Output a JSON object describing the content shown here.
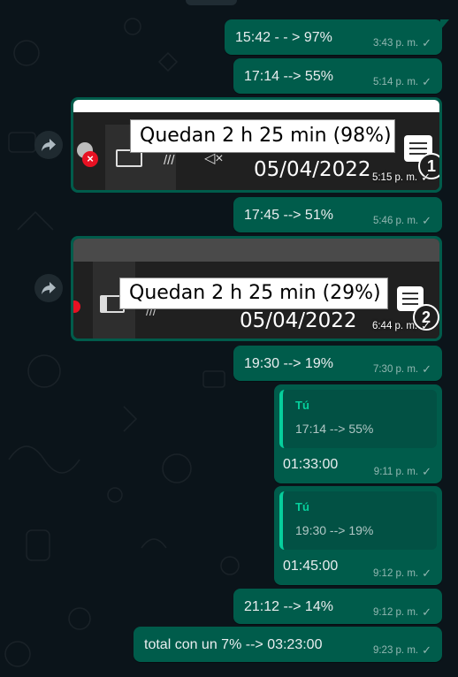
{
  "screenshot_1": {
    "tooltip": "Quedan 2 h 25 min (98%)",
    "date": "05/04/2022",
    "badge": "1",
    "time": "5:15 p. m."
  },
  "screenshot_2": {
    "tooltip": "Quedan 2 h 25 min (29%)",
    "date": "05/04/2022",
    "badge": "2",
    "time": "6:44 p. m."
  },
  "messages": [
    {
      "text": "15:42 - - > 97%",
      "time": "3:43 p. m."
    },
    {
      "text": "17:14 --> 55%",
      "time": "5:14 p. m."
    },
    {
      "text": "17:45 --> 51%",
      "time": "5:46 p. m."
    },
    {
      "text": "19:30 --> 19%",
      "time": "7:30 p. m."
    },
    {
      "text": "21:12 --> 14%",
      "time": "9:12 p. m."
    },
    {
      "text": "total con un 7% --> 03:23:00",
      "time": "9:23 p. m."
    }
  ],
  "replies": [
    {
      "author": "Tú",
      "quoted": "17:14 --> 55%",
      "text": "01:33:00",
      "time": "9:11 p. m."
    },
    {
      "author": "Tú",
      "quoted": "19:30 --> 19%",
      "text": "01:45:00",
      "time": "9:12 p. m."
    }
  ],
  "colors": {
    "outgoing": "#005c4b",
    "background": "#0b141a",
    "quote_accent": "#06cf9c"
  }
}
